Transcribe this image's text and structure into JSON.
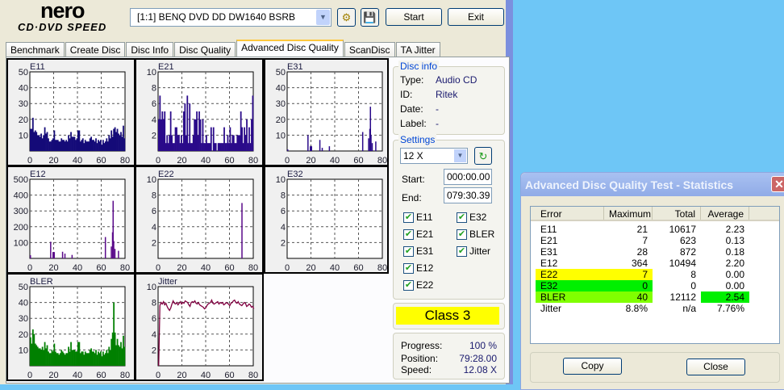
{
  "app": {
    "logo_top": "nero",
    "logo_bottom": "CD·DVD SPEED",
    "drive": "[1:1]   BENQ DVD DD DW1640 BSRB",
    "start": "Start",
    "exit": "Exit"
  },
  "tabs": [
    "Benchmark",
    "Create Disc",
    "Disc Info",
    "Disc Quality",
    "Advanced Disc Quality",
    "ScanDisc",
    "TA Jitter"
  ],
  "disc_info": {
    "title": "Disc info",
    "rows": [
      {
        "k": "Type:",
        "v": "Audio CD"
      },
      {
        "k": "ID:",
        "v": "Ritek"
      },
      {
        "k": "Date:",
        "v": "-"
      },
      {
        "k": "Label:",
        "v": "-"
      }
    ]
  },
  "settings": {
    "title": "Settings",
    "speed": "12 X",
    "start_label": "Start:",
    "start": "000:00.00",
    "end_label": "End:",
    "end": "079:30.39",
    "checks": [
      {
        "label": "E11",
        "checked": true
      },
      {
        "label": "E21",
        "checked": true
      },
      {
        "label": "E31",
        "checked": true
      },
      {
        "label": "E12",
        "checked": true
      },
      {
        "label": "E22",
        "checked": true
      },
      {
        "label": "E32",
        "checked": true
      },
      {
        "label": "BLER",
        "checked": true
      },
      {
        "label": "Jitter",
        "checked": true
      }
    ]
  },
  "result": {
    "class": "Class 3"
  },
  "status": {
    "progress_label": "Progress:",
    "progress": "100 %",
    "position_label": "Position:",
    "position": "79:28.00",
    "speed_label": "Speed:",
    "speed": "12.08 X"
  },
  "stats": {
    "title": "Advanced Disc Quality Test - Statistics",
    "headers": [
      "Error",
      "Maximum",
      "Total",
      "Average"
    ],
    "rows": [
      [
        "E11",
        "21",
        "10617",
        "2.23"
      ],
      [
        "E21",
        "7",
        "623",
        "0.13"
      ],
      [
        "E31",
        "28",
        "872",
        "0.18"
      ],
      [
        "E12",
        "364",
        "10494",
        "2.20"
      ],
      [
        "E22",
        "7",
        "8",
        "0.00"
      ],
      [
        "E32",
        "0",
        "0",
        "0.00"
      ],
      [
        "BLER",
        "40",
        "12112",
        "2.54"
      ],
      [
        "Jitter",
        "8.8%",
        "n/a",
        "7.76%"
      ]
    ],
    "highlights": {
      "E22": "#ffff00",
      "E32": "#00f000",
      "BLER": "#80ff00",
      "BLER_avg": "#00f000"
    },
    "copy": "Copy",
    "close": "Close"
  },
  "chart_data": [
    {
      "type": "bar",
      "title": "E11",
      "xlim": [
        0,
        80
      ],
      "ylim": [
        0,
        50
      ],
      "xticks": [
        "0",
        "20",
        "40",
        "60",
        "80"
      ],
      "yticks": [
        "10",
        "20",
        "30",
        "40",
        "50"
      ],
      "color": "#140a78",
      "values": [
        14,
        14,
        21,
        12,
        13,
        12,
        10,
        10,
        9,
        11,
        8,
        10,
        15,
        11,
        12,
        8,
        6,
        6,
        7,
        8,
        13,
        7,
        7,
        7,
        6,
        6,
        8,
        7,
        7,
        6,
        7,
        6,
        10,
        8,
        12,
        9,
        9,
        9,
        7,
        8,
        13,
        13,
        6,
        7,
        8,
        5,
        7,
        6,
        6,
        6,
        8,
        9,
        7,
        7,
        6,
        8,
        5,
        7,
        6,
        7,
        4,
        7,
        5,
        6,
        8,
        6,
        10,
        8,
        13,
        9,
        14,
        15,
        12,
        14,
        11,
        10,
        12,
        9,
        16,
        8
      ]
    },
    {
      "type": "bar",
      "title": "E21",
      "xlim": [
        0,
        80
      ],
      "ylim": [
        0,
        10
      ],
      "xticks": [
        "0",
        "20",
        "40",
        "60",
        "80"
      ],
      "yticks": [
        "2",
        "4",
        "6",
        "8",
        "10"
      ],
      "color": "#2a0a8a",
      "values": [
        4,
        7,
        4,
        5,
        4,
        5,
        1,
        2,
        1,
        2,
        5,
        2,
        1,
        1,
        3,
        3,
        2,
        2,
        1,
        2,
        1,
        5,
        6,
        2,
        7,
        1,
        6,
        1,
        1,
        2,
        4,
        4,
        5,
        2,
        5,
        4,
        1,
        4,
        1,
        1,
        2,
        1,
        1,
        1,
        3,
        0,
        3,
        1,
        1,
        0,
        1,
        1,
        1,
        1,
        1,
        3,
        1,
        1,
        2,
        1,
        3,
        1,
        2,
        2,
        1,
        1,
        2,
        2,
        2,
        5,
        3,
        1,
        3,
        2,
        4,
        1,
        3,
        1,
        4,
        7
      ]
    },
    {
      "type": "bar",
      "title": "E31",
      "xlim": [
        0,
        80
      ],
      "ylim": [
        0,
        50
      ],
      "xticks": [
        "0",
        "20",
        "40",
        "60",
        "80"
      ],
      "yticks": [
        "10",
        "20",
        "30",
        "40",
        "50"
      ],
      "color": "#2a0a8a",
      "points": [
        [
          0,
          1
        ],
        [
          17,
          10
        ],
        [
          19,
          3
        ],
        [
          20,
          3
        ],
        [
          27,
          7
        ],
        [
          29,
          2
        ],
        [
          35,
          3
        ],
        [
          63,
          12
        ],
        [
          68,
          8
        ],
        [
          69,
          14
        ],
        [
          69.5,
          28
        ],
        [
          70,
          10
        ],
        [
          71,
          5
        ],
        [
          74,
          6
        ]
      ]
    },
    {
      "type": "bar",
      "title": "E12",
      "xlim": [
        0,
        80
      ],
      "ylim": [
        0,
        500
      ],
      "xticks": [
        "0",
        "20",
        "40",
        "60",
        "80"
      ],
      "yticks": [
        "100",
        "200",
        "300",
        "400",
        "500"
      ],
      "color": "#5a0a8a",
      "points": [
        [
          0,
          20
        ],
        [
          17,
          105
        ],
        [
          19,
          40
        ],
        [
          20,
          40
        ],
        [
          27,
          42
        ],
        [
          29,
          30
        ],
        [
          35,
          22
        ],
        [
          63,
          135
        ],
        [
          68,
          75
        ],
        [
          69,
          165
        ],
        [
          69.5,
          364
        ],
        [
          70,
          110
        ],
        [
          71,
          60
        ],
        [
          74,
          48
        ]
      ]
    },
    {
      "type": "bar",
      "title": "E22",
      "xlim": [
        0,
        80
      ],
      "ylim": [
        0,
        10
      ],
      "xticks": [
        "0",
        "20",
        "40",
        "60",
        "80"
      ],
      "yticks": [
        "2",
        "4",
        "6",
        "8",
        "10"
      ],
      "color": "#5a0a8a",
      "points": [
        [
          70,
          7
        ]
      ]
    },
    {
      "type": "bar",
      "title": "E32",
      "xlim": [
        0,
        80
      ],
      "ylim": [
        0,
        10
      ],
      "xticks": [
        "0",
        "20",
        "40",
        "60",
        "80"
      ],
      "yticks": [
        "2",
        "4",
        "6",
        "8",
        "10"
      ],
      "color": "#5a0a8a",
      "points": []
    },
    {
      "type": "bar",
      "title": "BLER",
      "xlim": [
        0,
        80
      ],
      "ylim": [
        0,
        50
      ],
      "xticks": [
        "0",
        "20",
        "40",
        "60",
        "80"
      ],
      "yticks": [
        "10",
        "20",
        "30",
        "40",
        "50"
      ],
      "color": "#008000",
      "values": [
        18,
        14,
        23,
        20,
        14,
        13,
        12,
        11,
        11,
        10,
        12,
        10,
        15,
        11,
        13,
        9,
        8,
        8,
        10,
        9,
        14,
        9,
        8,
        8,
        7,
        8,
        10,
        9,
        8,
        7,
        8,
        8,
        12,
        9,
        15,
        10,
        10,
        10,
        9,
        9,
        15,
        15,
        8,
        9,
        9,
        7,
        9,
        8,
        8,
        8,
        10,
        11,
        9,
        9,
        8,
        10,
        7,
        9,
        8,
        9,
        6,
        9,
        7,
        8,
        10,
        8,
        12,
        10,
        17,
        21,
        40,
        21,
        13,
        17,
        13,
        12,
        15,
        11,
        19,
        12
      ]
    },
    {
      "type": "line",
      "title": "Jitter",
      "xlim": [
        0,
        80
      ],
      "ylim": [
        0,
        10
      ],
      "xticks": [
        "0",
        "20",
        "40",
        "60",
        "80"
      ],
      "yticks": [
        "2",
        "4",
        "6",
        "8",
        "10"
      ],
      "color": "#800040",
      "values": [
        0,
        7.6,
        8.0,
        7.8,
        8.1,
        7.7,
        7.9,
        7.5,
        7.2,
        7.0,
        7.3,
        7.8,
        8.2,
        7.9,
        7.8,
        8.0,
        7.7,
        7.9,
        8.1,
        7.8,
        8.0,
        7.9,
        8.2,
        8.1,
        8.0,
        7.7,
        7.5,
        8.0,
        8.1,
        8.0,
        8.2,
        7.9,
        7.8,
        8.0,
        7.7,
        7.6,
        7.5,
        7.4,
        7.2,
        7.3,
        7.6,
        7.8,
        7.9,
        8.0,
        8.3,
        7.9,
        7.8,
        7.9,
        8.0,
        8.1,
        7.8,
        8.0,
        7.9,
        8.0,
        7.7,
        7.8,
        8.0,
        7.9,
        7.8,
        7.6,
        7.9,
        8.0,
        8.2,
        8.3,
        8.0,
        7.9,
        8.1,
        7.8,
        7.7,
        7.6,
        7.8,
        8.0,
        7.9,
        7.5,
        7.6,
        7.8,
        7.7,
        7.4,
        7.5,
        7.2
      ]
    }
  ]
}
